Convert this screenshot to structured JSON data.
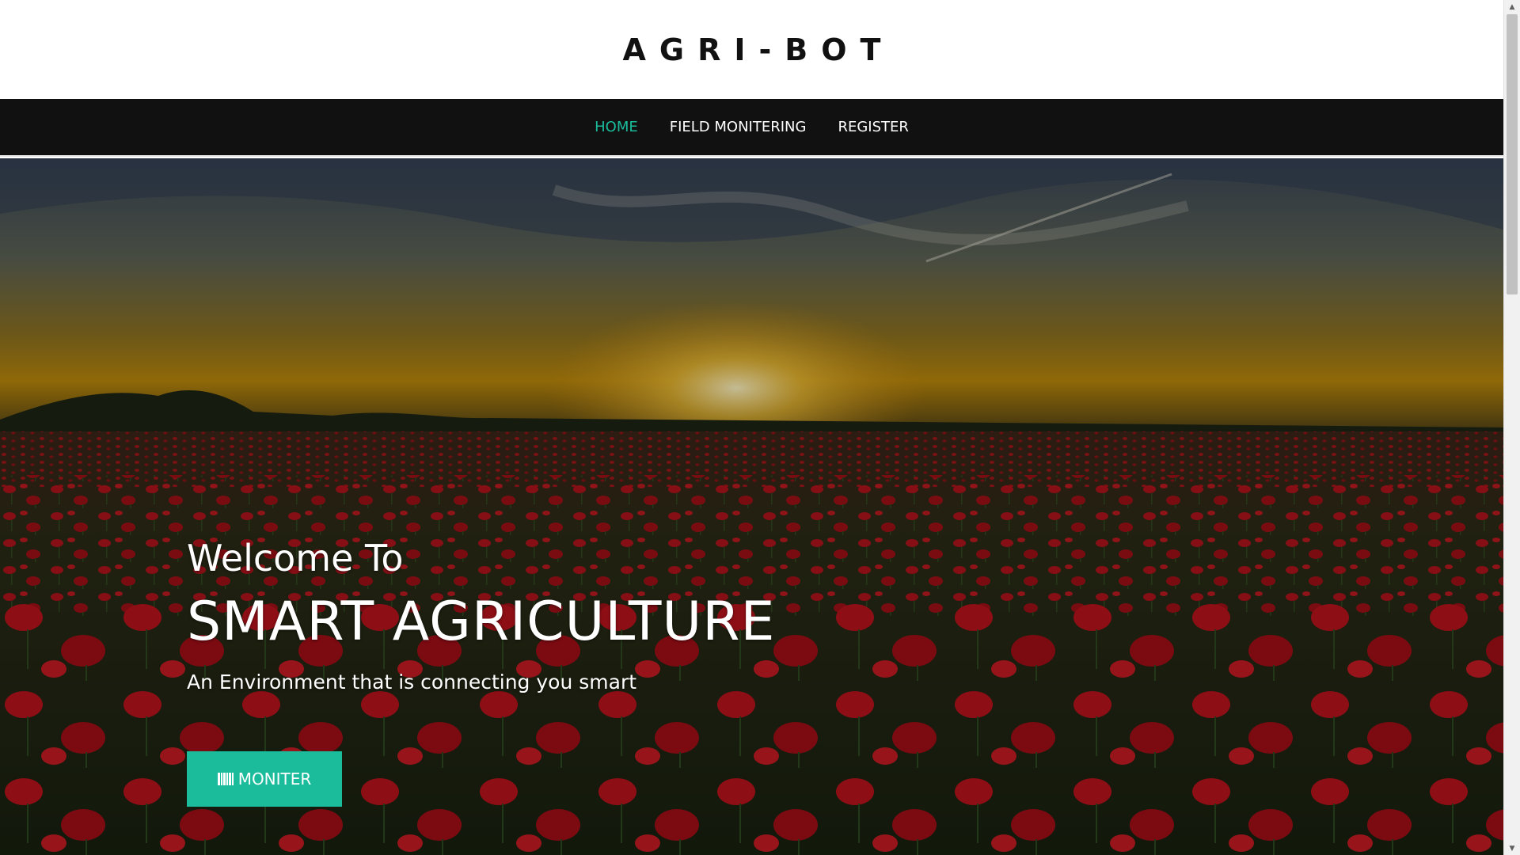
{
  "header": {
    "brand": "AGRI-BOT"
  },
  "nav": {
    "items": [
      {
        "label": "HOME",
        "active": true
      },
      {
        "label": "FIELD MONITERING",
        "active": false
      },
      {
        "label": "REGISTER",
        "active": false
      }
    ]
  },
  "hero": {
    "welcome": "Welcome To",
    "title": "SMART AGRICULTURE",
    "subtitle": "An Environment that is connecting you smart",
    "button_label": "MONITER",
    "button_icon": "barcode-icon",
    "background_image": "poppy-field-sunset"
  },
  "colors": {
    "accent": "#1abc9c",
    "navbar_bg": "#111111",
    "header_bg": "#ffffff",
    "brand_text": "#111111"
  }
}
